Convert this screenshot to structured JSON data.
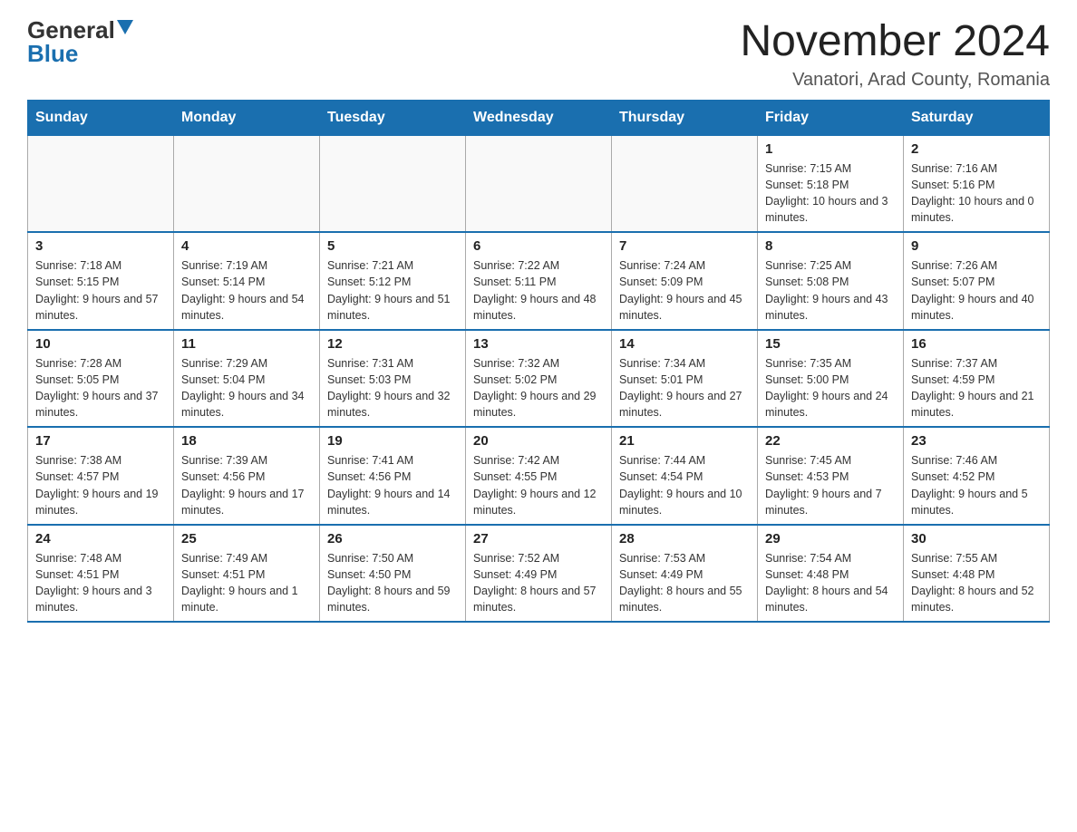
{
  "header": {
    "logo_general": "General",
    "logo_blue": "Blue",
    "month_title": "November 2024",
    "location": "Vanatori, Arad County, Romania"
  },
  "days_of_week": [
    "Sunday",
    "Monday",
    "Tuesday",
    "Wednesday",
    "Thursday",
    "Friday",
    "Saturday"
  ],
  "weeks": [
    [
      {
        "day": "",
        "info": ""
      },
      {
        "day": "",
        "info": ""
      },
      {
        "day": "",
        "info": ""
      },
      {
        "day": "",
        "info": ""
      },
      {
        "day": "",
        "info": ""
      },
      {
        "day": "1",
        "info": "Sunrise: 7:15 AM\nSunset: 5:18 PM\nDaylight: 10 hours and 3 minutes."
      },
      {
        "day": "2",
        "info": "Sunrise: 7:16 AM\nSunset: 5:16 PM\nDaylight: 10 hours and 0 minutes."
      }
    ],
    [
      {
        "day": "3",
        "info": "Sunrise: 7:18 AM\nSunset: 5:15 PM\nDaylight: 9 hours and 57 minutes."
      },
      {
        "day": "4",
        "info": "Sunrise: 7:19 AM\nSunset: 5:14 PM\nDaylight: 9 hours and 54 minutes."
      },
      {
        "day": "5",
        "info": "Sunrise: 7:21 AM\nSunset: 5:12 PM\nDaylight: 9 hours and 51 minutes."
      },
      {
        "day": "6",
        "info": "Sunrise: 7:22 AM\nSunset: 5:11 PM\nDaylight: 9 hours and 48 minutes."
      },
      {
        "day": "7",
        "info": "Sunrise: 7:24 AM\nSunset: 5:09 PM\nDaylight: 9 hours and 45 minutes."
      },
      {
        "day": "8",
        "info": "Sunrise: 7:25 AM\nSunset: 5:08 PM\nDaylight: 9 hours and 43 minutes."
      },
      {
        "day": "9",
        "info": "Sunrise: 7:26 AM\nSunset: 5:07 PM\nDaylight: 9 hours and 40 minutes."
      }
    ],
    [
      {
        "day": "10",
        "info": "Sunrise: 7:28 AM\nSunset: 5:05 PM\nDaylight: 9 hours and 37 minutes."
      },
      {
        "day": "11",
        "info": "Sunrise: 7:29 AM\nSunset: 5:04 PM\nDaylight: 9 hours and 34 minutes."
      },
      {
        "day": "12",
        "info": "Sunrise: 7:31 AM\nSunset: 5:03 PM\nDaylight: 9 hours and 32 minutes."
      },
      {
        "day": "13",
        "info": "Sunrise: 7:32 AM\nSunset: 5:02 PM\nDaylight: 9 hours and 29 minutes."
      },
      {
        "day": "14",
        "info": "Sunrise: 7:34 AM\nSunset: 5:01 PM\nDaylight: 9 hours and 27 minutes."
      },
      {
        "day": "15",
        "info": "Sunrise: 7:35 AM\nSunset: 5:00 PM\nDaylight: 9 hours and 24 minutes."
      },
      {
        "day": "16",
        "info": "Sunrise: 7:37 AM\nSunset: 4:59 PM\nDaylight: 9 hours and 21 minutes."
      }
    ],
    [
      {
        "day": "17",
        "info": "Sunrise: 7:38 AM\nSunset: 4:57 PM\nDaylight: 9 hours and 19 minutes."
      },
      {
        "day": "18",
        "info": "Sunrise: 7:39 AM\nSunset: 4:56 PM\nDaylight: 9 hours and 17 minutes."
      },
      {
        "day": "19",
        "info": "Sunrise: 7:41 AM\nSunset: 4:56 PM\nDaylight: 9 hours and 14 minutes."
      },
      {
        "day": "20",
        "info": "Sunrise: 7:42 AM\nSunset: 4:55 PM\nDaylight: 9 hours and 12 minutes."
      },
      {
        "day": "21",
        "info": "Sunrise: 7:44 AM\nSunset: 4:54 PM\nDaylight: 9 hours and 10 minutes."
      },
      {
        "day": "22",
        "info": "Sunrise: 7:45 AM\nSunset: 4:53 PM\nDaylight: 9 hours and 7 minutes."
      },
      {
        "day": "23",
        "info": "Sunrise: 7:46 AM\nSunset: 4:52 PM\nDaylight: 9 hours and 5 minutes."
      }
    ],
    [
      {
        "day": "24",
        "info": "Sunrise: 7:48 AM\nSunset: 4:51 PM\nDaylight: 9 hours and 3 minutes."
      },
      {
        "day": "25",
        "info": "Sunrise: 7:49 AM\nSunset: 4:51 PM\nDaylight: 9 hours and 1 minute."
      },
      {
        "day": "26",
        "info": "Sunrise: 7:50 AM\nSunset: 4:50 PM\nDaylight: 8 hours and 59 minutes."
      },
      {
        "day": "27",
        "info": "Sunrise: 7:52 AM\nSunset: 4:49 PM\nDaylight: 8 hours and 57 minutes."
      },
      {
        "day": "28",
        "info": "Sunrise: 7:53 AM\nSunset: 4:49 PM\nDaylight: 8 hours and 55 minutes."
      },
      {
        "day": "29",
        "info": "Sunrise: 7:54 AM\nSunset: 4:48 PM\nDaylight: 8 hours and 54 minutes."
      },
      {
        "day": "30",
        "info": "Sunrise: 7:55 AM\nSunset: 4:48 PM\nDaylight: 8 hours and 52 minutes."
      }
    ]
  ]
}
